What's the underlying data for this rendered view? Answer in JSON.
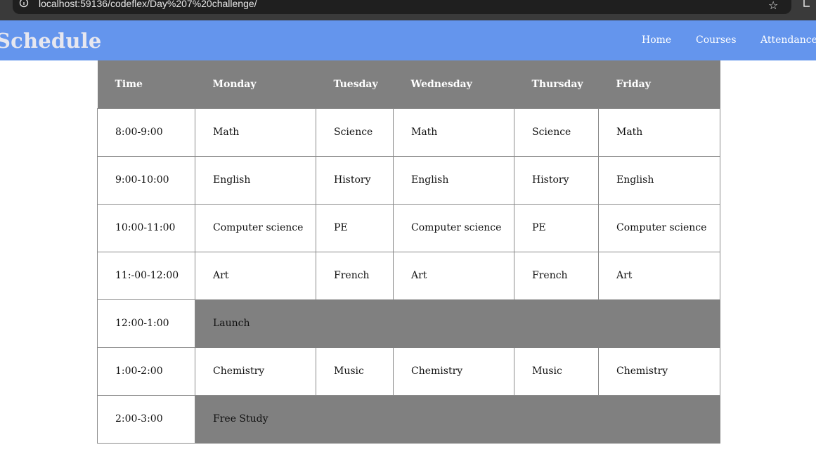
{
  "browser": {
    "url": "localhost:59136/codeflex/Day%207%20challenge/"
  },
  "header": {
    "title": "Schedule",
    "nav": [
      "Home",
      "Courses",
      "Attendance"
    ]
  },
  "schedule": {
    "columns": [
      "Time",
      "Monday",
      "Tuesday",
      "Wednesday",
      "Thursday",
      "Friday"
    ],
    "rows": [
      {
        "time": "8:00-9:00",
        "cells": [
          "Math",
          "Science",
          "Math",
          "Science",
          "Math"
        ]
      },
      {
        "time": "9:00-10:00",
        "cells": [
          "English",
          "History",
          "English",
          "History",
          "English"
        ]
      },
      {
        "time": "10:00-11:00",
        "cells": [
          "Computer science",
          "PE",
          "Computer science",
          "PE",
          "Computer science"
        ]
      },
      {
        "time": "11:-00-12:00",
        "cells": [
          "Art",
          "French",
          "Art",
          "French",
          "Art"
        ]
      },
      {
        "time": "12:00-1:00",
        "span": "Launch"
      },
      {
        "time": "1:00-2:00",
        "cells": [
          "Chemistry",
          "Music",
          "Chemistry",
          "Music",
          "Chemistry"
        ]
      },
      {
        "time": "2:00-3:00",
        "span": "Free Study"
      }
    ]
  },
  "colors": {
    "header_bg": "#6495ed",
    "table_header_bg": "#808080",
    "span_row_bg": "#808080",
    "border": "#8a8a8a"
  }
}
